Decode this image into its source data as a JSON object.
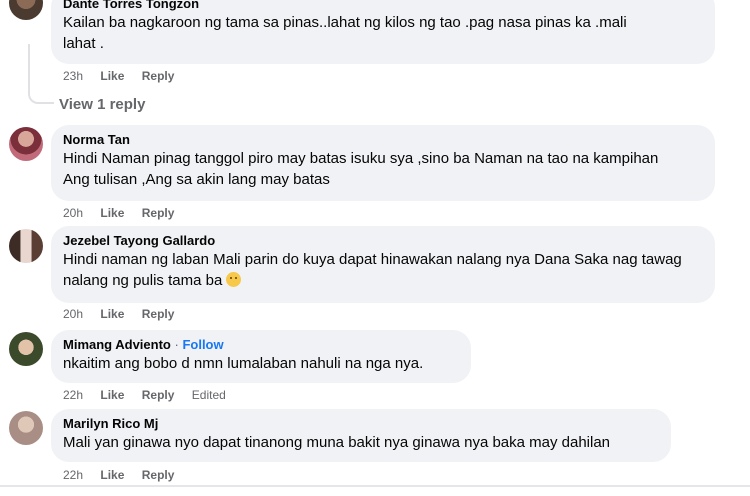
{
  "comments": [
    {
      "author": "Dante Torres Tongzon",
      "text": "Kailan ba nagkaroon ng tama sa pinas..lahat ng kilos ng tao .pag nasa pinas ka .mali lahat .",
      "time": "23h",
      "like": "Like",
      "reply": "Reply",
      "view_replies": "View 1 reply"
    },
    {
      "author": "Norma Tan",
      "text": "Hindi Naman pinag tanggol piro may batas isuku sya ,sino ba Naman na tao na kampihan Ang tulisan ,Ang sa akin lang may batas",
      "time": "20h",
      "like": "Like",
      "reply": "Reply"
    },
    {
      "author": "Jezebel Tayong Gallardo",
      "text": "Hindi naman ng laban Mali parin do kuya dapat hinawakan nalang nya Dana Saka nag tawag nalang ng pulis tama ba",
      "emoji": "sad-face-emoji",
      "time": "20h",
      "like": "Like",
      "reply": "Reply"
    },
    {
      "author": "Mimang Adviento",
      "follow": "Follow",
      "separator": "·",
      "text": "nkaitim ang bobo d nmn lumalaban nahuli na nga nya.",
      "time": "22h",
      "like": "Like",
      "reply": "Reply",
      "edited": "Edited"
    },
    {
      "author": "Marilyn Rico Mj",
      "text": "Mali yan ginawa nyo dapat tinanong muna bakit nya ginawa nya baka may dahilan",
      "time": "22h",
      "like": "Like",
      "reply": "Reply"
    }
  ],
  "colors": {
    "bubble": "#f0f2f5",
    "meta": "#65676b",
    "follow": "#1877f2"
  }
}
